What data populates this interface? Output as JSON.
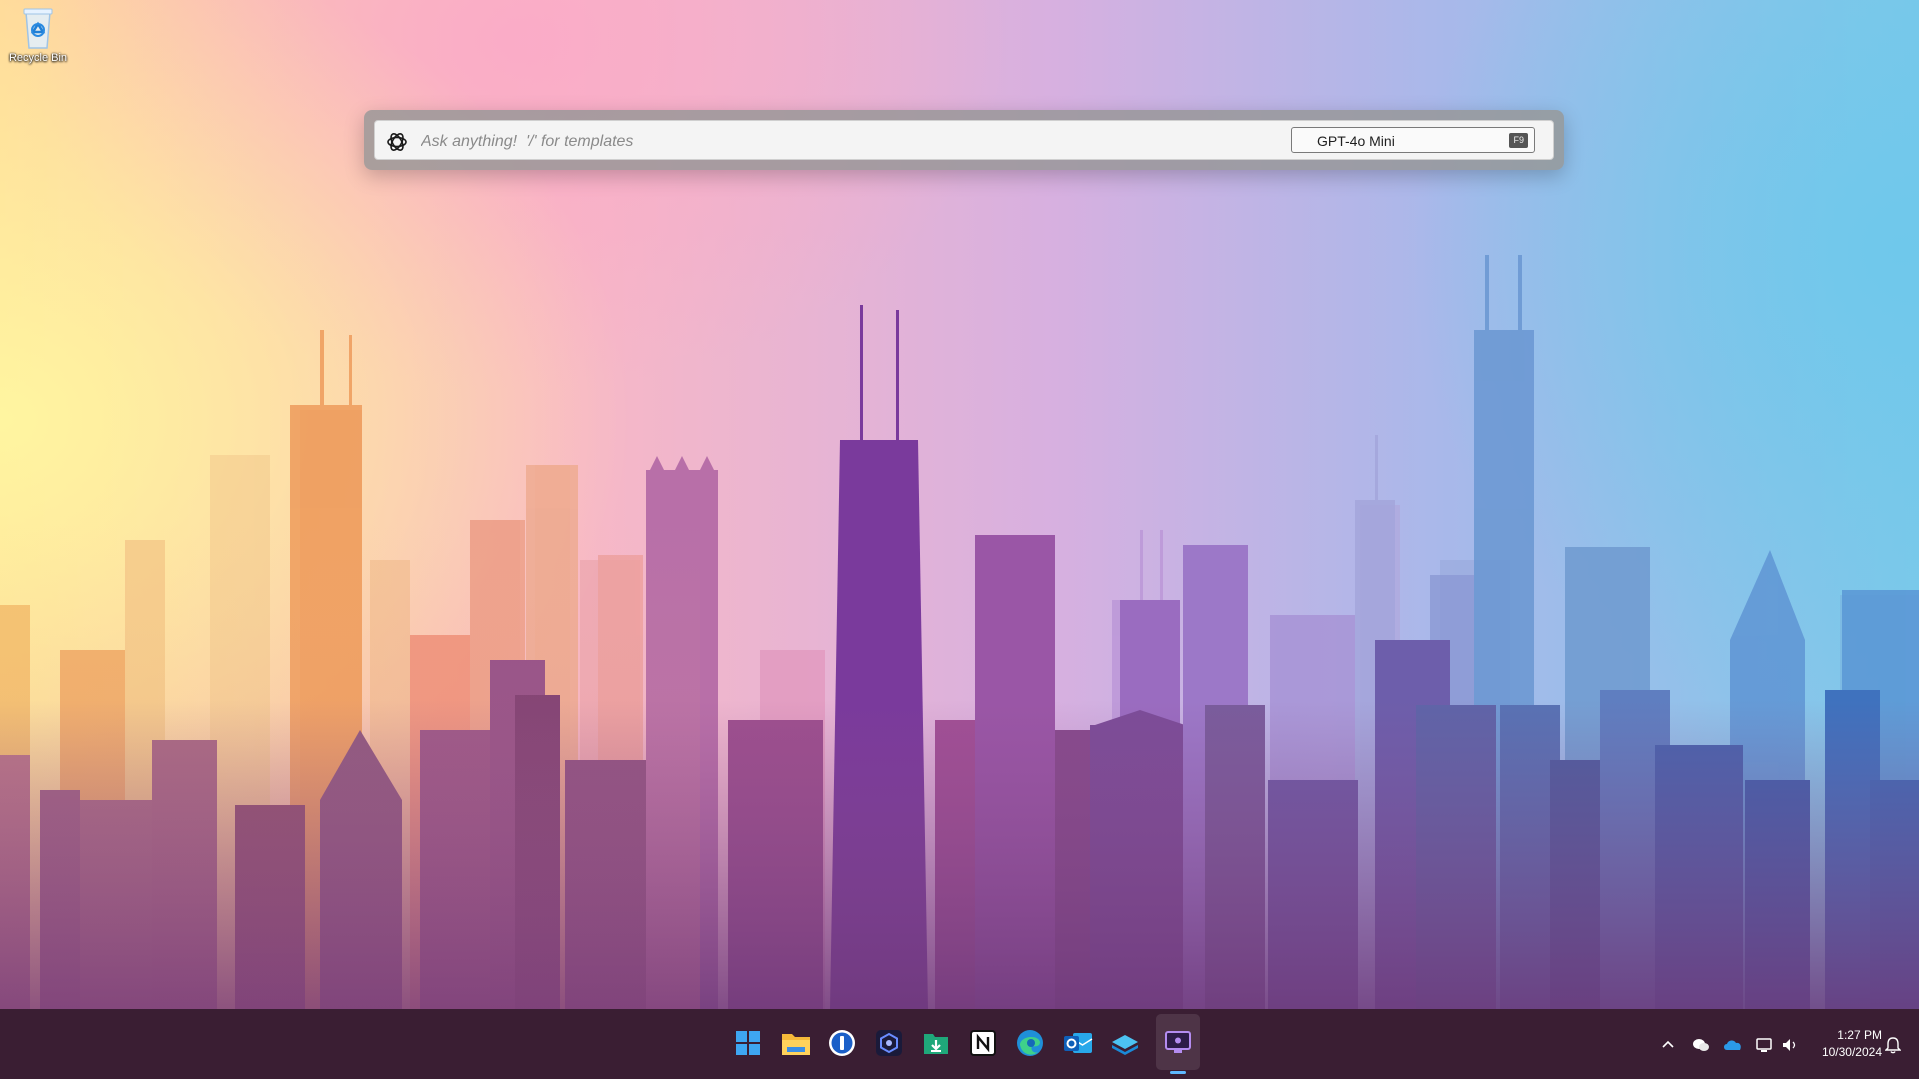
{
  "desktop": {
    "icons": [
      {
        "label": "Recycle Bin",
        "icon": "recycle-bin-icon"
      }
    ]
  },
  "prompt_bar": {
    "placeholder": "Ask anything!  '/' for templates",
    "value": "",
    "model": "GPT-4o Mini",
    "model_shortcut": "F9",
    "logo_icon": "openai-logo-icon"
  },
  "taskbar": {
    "apps": [
      {
        "name": "start",
        "icon": "windows-start-icon"
      },
      {
        "name": "file-explorer",
        "icon": "folder-icon"
      },
      {
        "name": "1password",
        "icon": "1password-icon"
      },
      {
        "name": "app-launcher",
        "icon": "hexagon-app-icon"
      },
      {
        "name": "downloader",
        "icon": "download-icon"
      },
      {
        "name": "notion",
        "icon": "notion-icon"
      },
      {
        "name": "edge",
        "icon": "edge-icon"
      },
      {
        "name": "outlook",
        "icon": "outlook-icon"
      },
      {
        "name": "stack-app",
        "icon": "stack-icon"
      },
      {
        "name": "remote-desktop",
        "icon": "monitor-icon",
        "active": true
      }
    ],
    "tray": [
      "chevron-up-icon",
      "wechat-icon",
      "onedrive-icon",
      "network-icon",
      "volume-icon"
    ],
    "time": "1:27 PM",
    "date": "10/30/2024",
    "notification_icon": "bell-icon"
  },
  "colors": {
    "taskbar": "#3a1e33",
    "accent": "#5fb8ff"
  }
}
